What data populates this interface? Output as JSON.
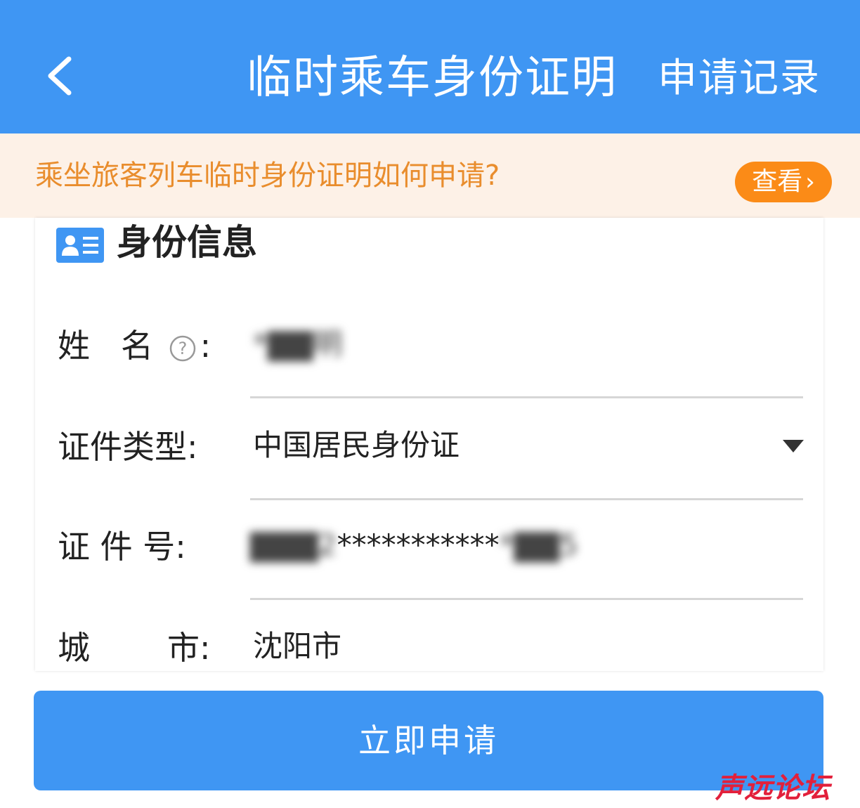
{
  "header": {
    "title": "临时乘车身份证明",
    "records_link": "申请记录"
  },
  "notice": {
    "text": "乘坐旅客列车临时身份证明如何申请?",
    "view_button": "查看",
    "view_chevron": "›"
  },
  "identity": {
    "section_title": "身份信息",
    "name": {
      "label_a": "姓",
      "label_b": "名",
      "colon": ":",
      "value": "*▇▇明"
    },
    "doc_type": {
      "label": "证件类型:",
      "value": "中国居民身份证"
    },
    "doc_number": {
      "label": "证 件 号:",
      "value_masked_prefix": "▇▇▇2",
      "value_stars": "***********",
      "value_masked_suffix": "*▇▇5"
    },
    "city": {
      "label_a": "城",
      "label_b": "市:",
      "value": "沈阳市"
    }
  },
  "submit_button": "立即申请",
  "watermark": "声远论坛",
  "colors": {
    "primary_blue": "#3f96f3",
    "notice_bg": "#fdf1e7",
    "notice_text": "#e98d2d",
    "view_button": "#fb8b17",
    "watermark": "#e2203b"
  }
}
